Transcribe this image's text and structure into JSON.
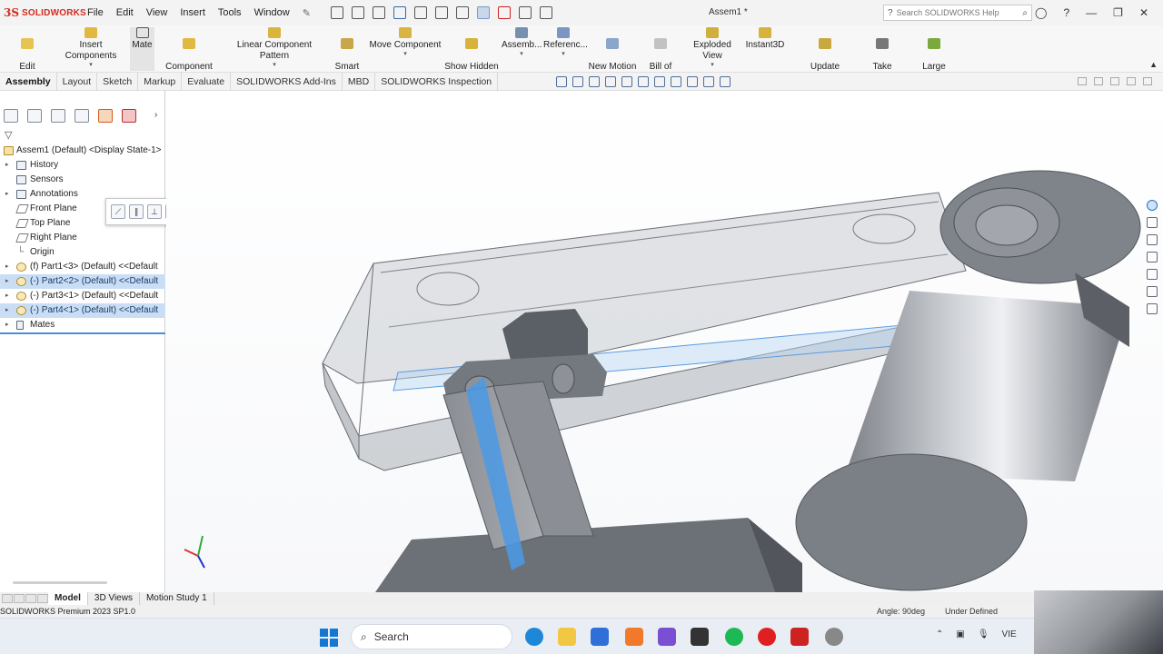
{
  "app": {
    "brand": "SOLIDWORKS",
    "title": "Assem1 *",
    "colors": {
      "brand_red": "#d52b1e",
      "selection_blue": "#3a8ee6",
      "feature_highlight": "#c9def5"
    }
  },
  "menu": [
    "File",
    "Edit",
    "View",
    "Insert",
    "Tools",
    "Window"
  ],
  "search": {
    "placeholder": "Search SOLIDWORKS Help"
  },
  "ribbon": {
    "edit_component": "Edit\nComponent",
    "insert_components": "Insert Components",
    "mate": "Mate",
    "component_preview": "Component\nPreview Window",
    "linear_pattern": "Linear Component Pattern",
    "smart_fasteners": "Smart\nFasteners",
    "move_component": "Move Component",
    "show_hidden": "Show Hidden\nComponents",
    "assembly": "Assemb...",
    "reference": "Referenc...",
    "new_motion": "New Motion\nStudy",
    "bom": "Bill of\nMaterials",
    "exploded_view": "Exploded View",
    "instant3d": "Instant3D",
    "speedpak": "Update SpeedPak\nSubassemblies",
    "snapshot": "Take\nSnapshot",
    "large_assembly": "Large Assembly\nSettings"
  },
  "tabs": [
    "Assembly",
    "Layout",
    "Sketch",
    "Markup",
    "Evaluate",
    "SOLIDWORKS Add-Ins",
    "MBD",
    "SOLIDWORKS Inspection"
  ],
  "tree": {
    "root": "Assem1 (Default) <Display State-1>",
    "items": [
      {
        "label": "History",
        "icon": "history-icon",
        "expand": true
      },
      {
        "label": "Sensors",
        "icon": "sensors-icon",
        "expand": false
      },
      {
        "label": "Annotations",
        "icon": "annotations-icon",
        "expand": true
      },
      {
        "label": "Front Plane",
        "icon": "plane-icon",
        "expand": false
      },
      {
        "label": "Top Plane",
        "icon": "plane-icon",
        "expand": false
      },
      {
        "label": "Right Plane",
        "icon": "plane-icon",
        "expand": false
      },
      {
        "label": "Origin",
        "icon": "origin-icon",
        "expand": false
      },
      {
        "label": "(f) Part1<3> (Default) <<Default",
        "icon": "part-icon",
        "expand": true,
        "selected": false
      },
      {
        "label": "(-) Part2<2> (Default) <<Default",
        "icon": "part-icon",
        "expand": true,
        "selected": true
      },
      {
        "label": "(-) Part3<1> (Default) <<Default",
        "icon": "part-icon",
        "expand": true,
        "selected": false
      },
      {
        "label": "(-) Part4<1> (Default) <<Default",
        "icon": "part-icon",
        "expand": true,
        "selected": true
      },
      {
        "label": "Mates",
        "icon": "mates-icon",
        "expand": true
      }
    ]
  },
  "mate_toolbar": [
    "coincident-icon",
    "parallel-icon",
    "perpendicular-icon",
    "lock-icon",
    "distance-icon",
    "angle-icon",
    "flip-icon",
    "ok-icon"
  ],
  "model_tabs": [
    "Model",
    "3D Views",
    "Motion Study 1"
  ],
  "status": {
    "product": "SOLIDWORKS Premium 2023 SP1.0",
    "angle": "Angle: 90deg",
    "definition": "Under Defined"
  },
  "taskbar": {
    "search_label": "Search",
    "lang": "VIE"
  }
}
